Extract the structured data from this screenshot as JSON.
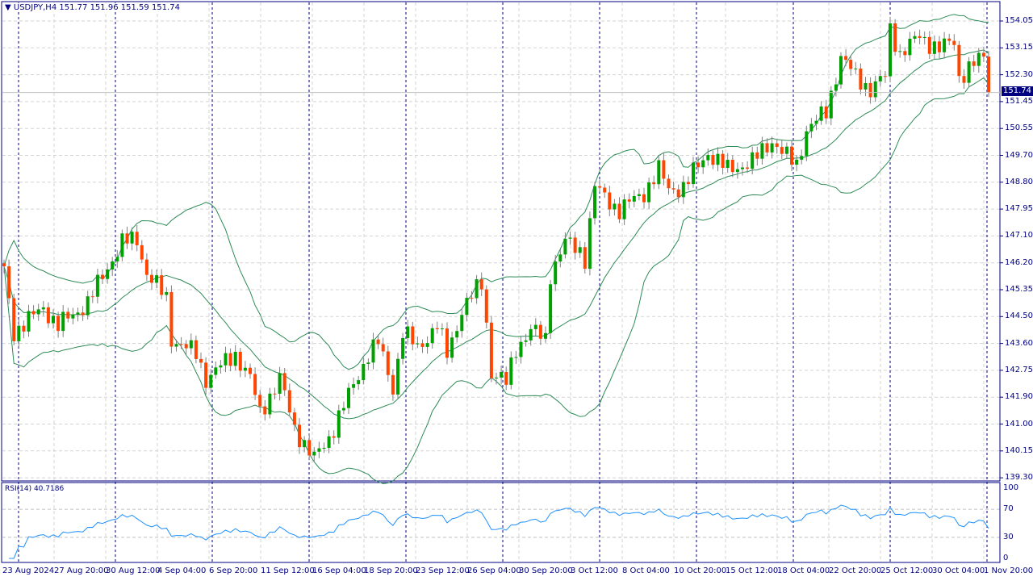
{
  "header": {
    "symbol": "USDJPY,H4",
    "open": "151.77",
    "high": "151.96",
    "low": "151.59",
    "close": "151.74"
  },
  "current_price": "151.74",
  "rsi": {
    "label": "RSI(14) 40.7186",
    "levels": [
      "100",
      "70",
      "30",
      "0"
    ]
  },
  "price_axis": [
    "154.05",
    "153.15",
    "152.30",
    "151.45",
    "150.55",
    "149.70",
    "148.80",
    "147.95",
    "147.10",
    "146.20",
    "145.35",
    "144.50",
    "143.60",
    "142.75",
    "141.90",
    "141.00",
    "140.15",
    "139.30"
  ],
  "time_axis": [
    "23 Aug 2024",
    "27 Aug 20:00",
    "30 Aug 12:00",
    "4 Sep 04:00",
    "6 Sep 20:00",
    "11 Sep 12:00",
    "16 Sep 04:00",
    "18 Sep 20:00",
    "23 Sep 12:00",
    "26 Sep 04:00",
    "30 Sep 20:00",
    "3 Oct 12:00",
    "8 Oct 04:00",
    "10 Oct 20:00",
    "15 Oct 12:00",
    "18 Oct 04:00",
    "22 Oct 20:00",
    "25 Oct 12:00",
    "30 Oct 04:00",
    "1 Nov 20:00"
  ],
  "colors": {
    "bull": "#00a000",
    "bear": "#ff4500",
    "bands": "#2e8b57",
    "rsi": "#1e90ff",
    "frame": "#000080"
  },
  "chart_data": {
    "type": "candlestick",
    "symbol": "USDJPY",
    "timeframe": "H4",
    "candles": 201,
    "ylim": [
      139.3,
      154.05
    ],
    "close_anchors": [
      [
        0,
        146.0
      ],
      [
        2,
        144.0
      ],
      [
        8,
        144.8
      ],
      [
        11,
        144.2
      ],
      [
        17,
        144.95
      ],
      [
        21,
        146.1
      ],
      [
        24,
        146.9
      ],
      [
        27,
        147.0
      ],
      [
        29,
        145.9
      ],
      [
        33,
        145.1
      ],
      [
        34,
        143.8
      ],
      [
        39,
        143.3
      ],
      [
        41,
        142.5
      ],
      [
        47,
        143.3
      ],
      [
        50,
        142.5
      ],
      [
        52,
        141.4
      ],
      [
        56,
        142.5
      ],
      [
        59,
        140.9
      ],
      [
        63,
        139.9
      ],
      [
        66,
        140.6
      ],
      [
        70,
        141.95
      ],
      [
        74,
        143.3
      ],
      [
        76,
        143.65
      ],
      [
        79,
        142.2
      ],
      [
        81,
        144.0
      ],
      [
        84,
        143.5
      ],
      [
        88,
        144.2
      ],
      [
        90,
        143.3
      ],
      [
        93,
        144.7
      ],
      [
        97,
        145.6
      ],
      [
        98,
        144.3
      ],
      [
        99,
        142.7
      ],
      [
        102,
        142.35
      ],
      [
        104,
        143.5
      ],
      [
        107,
        144.05
      ],
      [
        110,
        143.8
      ],
      [
        111,
        145.9
      ],
      [
        114,
        146.9
      ],
      [
        117,
        146.65
      ],
      [
        118,
        146.4
      ],
      [
        120,
        148.7
      ],
      [
        122,
        148.35
      ],
      [
        125,
        147.95
      ],
      [
        130,
        148.5
      ],
      [
        133,
        149.25
      ],
      [
        135,
        148.6
      ],
      [
        138,
        148.7
      ],
      [
        143,
        149.8
      ],
      [
        147,
        149.25
      ],
      [
        152,
        149.5
      ],
      [
        156,
        150.2
      ],
      [
        159,
        149.65
      ],
      [
        161,
        149.4
      ],
      [
        163,
        150.55
      ],
      [
        167,
        151.1
      ],
      [
        170,
        152.9
      ],
      [
        173,
        152.25
      ],
      [
        176,
        151.85
      ],
      [
        179,
        152.25
      ],
      [
        180,
        153.8
      ],
      [
        182,
        153.0
      ],
      [
        186,
        153.55
      ],
      [
        190,
        153.15
      ],
      [
        193,
        153.4
      ],
      [
        194,
        152.25
      ],
      [
        197,
        152.65
      ],
      [
        199,
        152.9
      ],
      [
        200,
        151.74
      ]
    ]
  }
}
